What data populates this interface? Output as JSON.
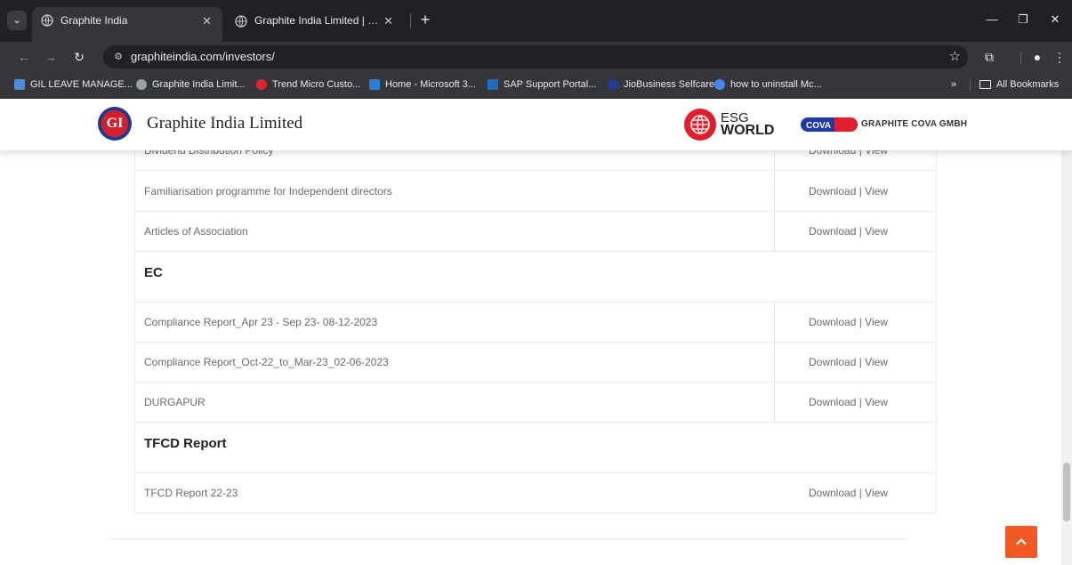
{
  "browser": {
    "tabs": [
      {
        "label": "Graphite India",
        "active": true
      },
      {
        "label": "Graphite India Limited | MyBac",
        "active": false
      }
    ],
    "url": "graphiteindia.com/investors/",
    "bookmarks": [
      {
        "label": "GIL LEAVE MANAGE...",
        "icon_color": "#4a90d9"
      },
      {
        "label": "Graphite India Limit...",
        "icon_color": "#9aa0a6"
      },
      {
        "label": "Trend Micro Custo...",
        "icon_color": "#d9262e"
      },
      {
        "label": "Home - Microsoft 3...",
        "icon_color": "#2b7cd3"
      },
      {
        "label": "SAP Support Portal...",
        "icon_color": "#1b6ec2"
      },
      {
        "label": "JioBusiness Selfcare",
        "icon_color": "#1c3f94"
      },
      {
        "label": "how to uninstall Mc...",
        "icon_color": "#4285f4"
      }
    ],
    "bookmarks_more": "»",
    "all_bookmarks": "All Bookmarks"
  },
  "header": {
    "logo_text": "GI",
    "site_name": "Graphite India Limited",
    "esg_line1": "ESG",
    "esg_line2": "WORLD",
    "cova_logo_text": "COVA",
    "cova_name": "GRAPHITE COVA GMBH"
  },
  "policy_rows": [
    {
      "title": "Dividend Distribution Policy",
      "download": "Download",
      "separator": " | ",
      "view": "View"
    },
    {
      "title": "Familiarisation programme for Independent directors",
      "download": "Download",
      "separator": " | ",
      "view": "View"
    },
    {
      "title": "Articles of Association",
      "download": "Download",
      "separator": " | ",
      "view": "View"
    }
  ],
  "ec_section": {
    "heading": "EC",
    "rows": [
      {
        "title": "Compliance Report_Apr 23 - Sep 23- 08-12-2023",
        "download": "Download",
        "separator": " | ",
        "view": "View"
      },
      {
        "title": "Compliance Report_Oct-22_to_Mar-23_02-06-2023",
        "download": "Download",
        "separator": " | ",
        "view": "View"
      },
      {
        "title": "DURGAPUR",
        "download": "Download",
        "separator": " | ",
        "view": "View"
      }
    ]
  },
  "tfcd_section": {
    "heading": "TFCD Report",
    "rows": [
      {
        "title": "TFCD Report 22-23",
        "download": "Download",
        "separator": " | ",
        "view": "View"
      }
    ]
  },
  "back_to_top_icon": "chevron-up",
  "accent_color": "#f15a24"
}
